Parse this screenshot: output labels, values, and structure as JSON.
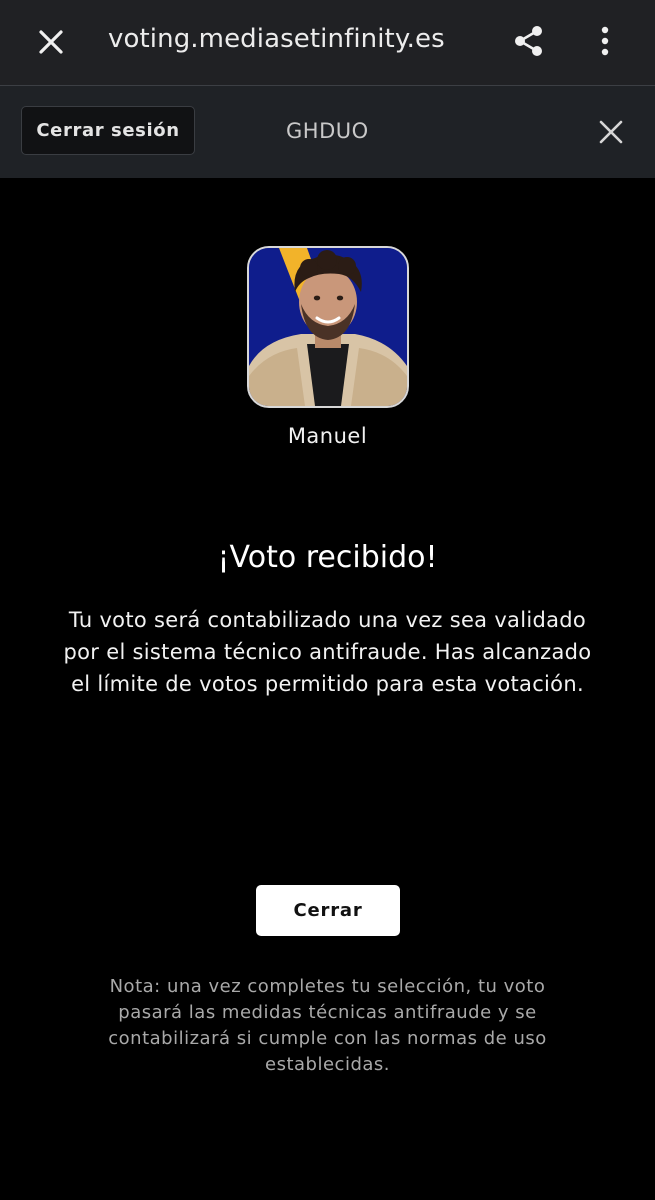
{
  "browser": {
    "url": "voting.mediasetinfinity.es",
    "close_icon": "close-icon",
    "share_icon": "share-icon",
    "menu_icon": "more-vertical-icon"
  },
  "header": {
    "logout_label": "Cerrar sesión",
    "code": "GHDUO",
    "close_icon": "close-icon"
  },
  "contestant": {
    "name": "Manuel",
    "photo_background": "#0f1d8c",
    "photo_accent": "#f2b32a"
  },
  "result": {
    "title": "¡Voto recibido!",
    "message": "Tu voto será contabilizado una vez sea validado por el sistema técnico antifraude. Has alcanzado el límite de votos permitido para esta votación."
  },
  "actions": {
    "close_label": "Cerrar"
  },
  "note": "Nota: una vez completes tu selección, tu voto pasará las medidas técnicas antifraude y se contabilizará si cumple con las normas de uso establecidas.",
  "colors": {
    "browser_bar": "#202124",
    "site_header": "#1f2226",
    "page_background": "#000000",
    "button_background": "#ffffff"
  }
}
